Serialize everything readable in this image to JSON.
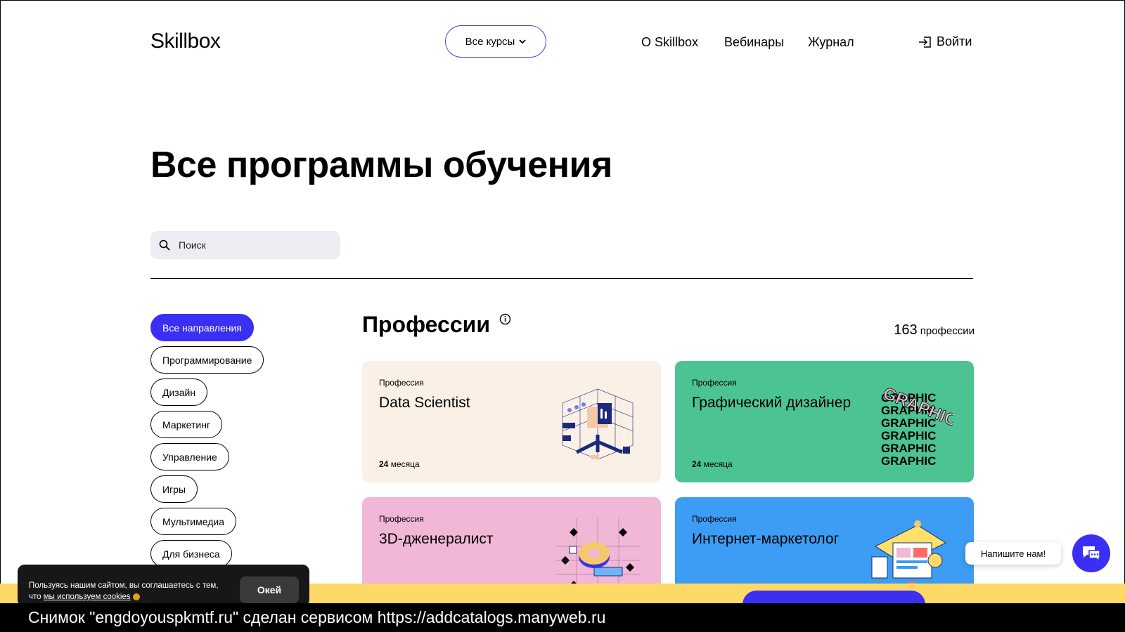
{
  "header": {
    "logo": "Skillbox",
    "courses_button": "Все курсы",
    "nav": [
      "О Skillbox",
      "Вебинары",
      "Журнал"
    ],
    "login": "Войти"
  },
  "page_title": "Все программы обучения",
  "search": {
    "placeholder": "Поиск"
  },
  "filters": [
    {
      "label": "Все направления",
      "active": true
    },
    {
      "label": "Программирование",
      "active": false
    },
    {
      "label": "Дизайн",
      "active": false
    },
    {
      "label": "Маркетинг",
      "active": false
    },
    {
      "label": "Управление",
      "active": false
    },
    {
      "label": "Игры",
      "active": false
    },
    {
      "label": "Мультимедиа",
      "active": false
    },
    {
      "label": "Для бизнеса",
      "active": false
    }
  ],
  "section": {
    "title": "Профессии",
    "count_number": "163",
    "count_label": "профессии"
  },
  "cards": [
    {
      "kind": "Профессия",
      "name": "Data Scientist",
      "duration_num": "24",
      "duration_unit": "месяца",
      "color": "#faf0e6"
    },
    {
      "kind": "Профессия",
      "name": "Графический дизайнер",
      "duration_num": "24",
      "duration_unit": "месяца",
      "color": "#4cc392"
    },
    {
      "kind": "Профессия",
      "name": "3D-дженералист",
      "duration_num": "",
      "duration_unit": "",
      "color": "#f0b7d6"
    },
    {
      "kind": "Профессия",
      "name": "Интернет-маркетолог",
      "duration_num": "",
      "duration_unit": "",
      "color": "#3d9cf3"
    }
  ],
  "graphic_word": "GRAPHIC",
  "chat": {
    "label": "Напишите нам!"
  },
  "cookie": {
    "text_before": "Пользуясь нашим сайтом, вы соглашаетесь с тем, что",
    "link": "мы используем cookies",
    "ok": "Окей"
  },
  "caption": "Снимок \"engdoyouspkmtf.ru\" сделан сервисом https://addcatalogs.manyweb.ru",
  "colors": {
    "accent": "#3a2ff2",
    "promo": "#ffd966"
  }
}
